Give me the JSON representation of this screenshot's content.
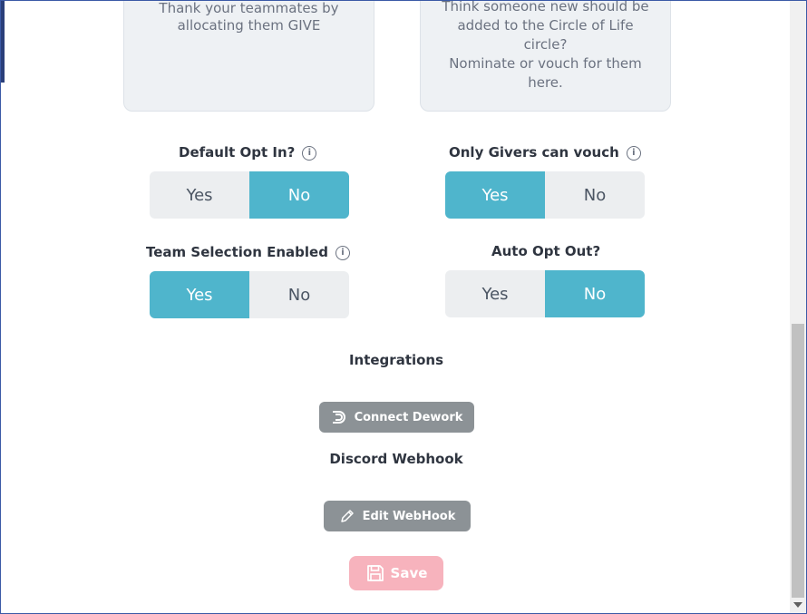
{
  "cards": {
    "give": {
      "lines": [
        "Thank your teammates by",
        "allocating them GIVE"
      ]
    },
    "vouch": {
      "lines": [
        "Think someone new should be",
        "added to the Circle of Life",
        "circle?",
        "Nominate or vouch for them",
        "here."
      ]
    }
  },
  "options": {
    "default_opt_in": {
      "label": "Default Opt In?",
      "info": "i",
      "yes": "Yes",
      "no": "No",
      "selected": "No"
    },
    "only_givers_vouch": {
      "label": "Only Givers can vouch",
      "info": "i",
      "yes": "Yes",
      "no": "No",
      "selected": "Yes"
    },
    "team_selection": {
      "label": "Team Selection Enabled",
      "info": "i",
      "yes": "Yes",
      "no": "No",
      "selected": "Yes"
    },
    "auto_opt_out": {
      "label": "Auto Opt Out?",
      "yes": "Yes",
      "no": "No",
      "selected": "No"
    }
  },
  "integrations": {
    "title": "Integrations",
    "connect_label": "Connect Dework",
    "connect_icon": "dework-logo-icon"
  },
  "webhook": {
    "title": "Discord Webhook",
    "edit_label": "Edit WebHook",
    "edit_icon": "pencil-icon"
  },
  "save": {
    "label": "Save",
    "icon": "floppy-disk-icon"
  },
  "colors": {
    "active": "#4fb5cc",
    "inactive": "#eceef0",
    "button_gray": "#8c9296",
    "save_disabled": "#f7b3bd"
  }
}
